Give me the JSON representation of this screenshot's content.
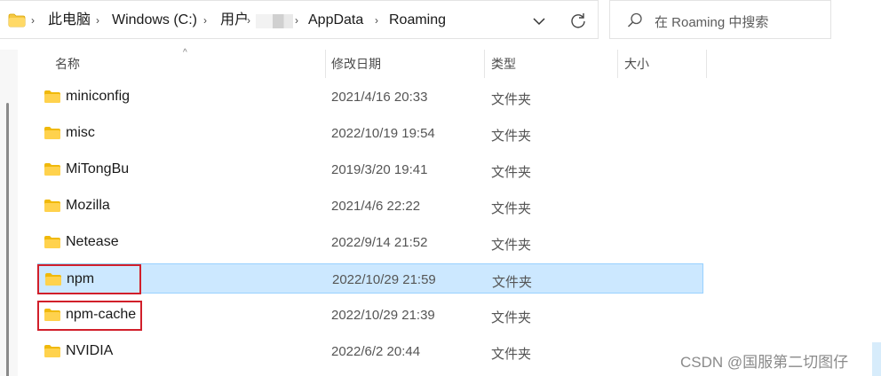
{
  "breadcrumb": {
    "items": [
      "此电脑",
      "Windows (C:)",
      "用户",
      "AppData",
      "Roaming"
    ]
  },
  "search": {
    "placeholder": "在 Roaming 中搜索"
  },
  "columns": {
    "name": "名称",
    "modified": "修改日期",
    "type": "类型",
    "size": "大小"
  },
  "files": [
    {
      "name": "miniconfig",
      "modified": "2021/4/16 20:33",
      "type": "文件夹",
      "selected": false,
      "highlighted": false
    },
    {
      "name": "misc",
      "modified": "2022/10/19 19:54",
      "type": "文件夹",
      "selected": false,
      "highlighted": false
    },
    {
      "name": "MiTongBu",
      "modified": "2019/3/20 19:41",
      "type": "文件夹",
      "selected": false,
      "highlighted": false
    },
    {
      "name": "Mozilla",
      "modified": "2021/4/6 22:22",
      "type": "文件夹",
      "selected": false,
      "highlighted": false
    },
    {
      "name": "Netease",
      "modified": "2022/9/14 21:52",
      "type": "文件夹",
      "selected": false,
      "highlighted": false
    },
    {
      "name": "npm",
      "modified": "2022/10/29 21:59",
      "type": "文件夹",
      "selected": true,
      "highlighted": true
    },
    {
      "name": "npm-cache",
      "modified": "2022/10/29 21:39",
      "type": "文件夹",
      "selected": false,
      "highlighted": true
    },
    {
      "name": "NVIDIA",
      "modified": "2022/6/2 20:44",
      "type": "文件夹",
      "selected": false,
      "highlighted": false
    }
  ],
  "icons": {
    "folder": "folder-icon",
    "search": "search-icon",
    "refresh": "refresh-icon",
    "dropdown": "chevron-down-icon",
    "separator": "chevron-right-icon"
  },
  "colors": {
    "selection": "#cce8ff",
    "highlight_box": "#d11f2a",
    "folder": "#f5c842"
  },
  "watermark": "CSDN @国服第二切图仔"
}
